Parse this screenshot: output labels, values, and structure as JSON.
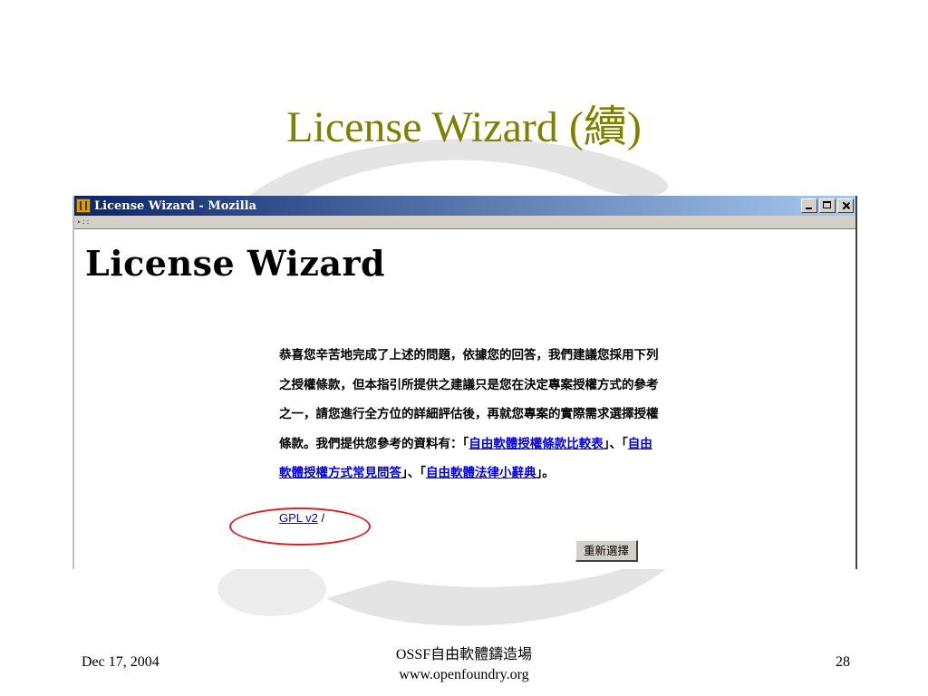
{
  "slide": {
    "title": "License Wizard (續)"
  },
  "window": {
    "title": "License Wizard - Mozilla",
    "icon": "mozilla-app-icon",
    "controls": [
      "minimize-icon",
      "maximize-icon",
      "close-icon"
    ]
  },
  "page": {
    "heading": "License Wizard",
    "paragraph": {
      "t1": "恭喜您辛苦地完成了上述的問題，依據您的回答，我們建議您採用下列之授權條款，但本指引所提供之建議只是您在決定專案授權方式的參考之一，請您進行全方位的詳細評估後，再就您專案的實際需求選擇授權條款。我們提供您參考的資料有：「",
      "link1": "自由軟體授權條款比較表",
      "t2": "」、「",
      "link2": "自由軟體授權方式常見問答",
      "t3": "」、「",
      "link3": "自由軟體法律小辭典",
      "t4": "」。"
    },
    "gpl_link": "GPL v2",
    "gpl_suffix": " /",
    "reset_button": "重新選擇"
  },
  "footer": {
    "date": "Dec 17, 2004",
    "org_line1": "OSSF自由軟體鑄造場",
    "org_line2": "www.openfoundry.org",
    "page_number": "28"
  },
  "colors": {
    "title": "#808000",
    "titlebar_start": "#0a246a",
    "titlebar_end": "#a6caf0",
    "link": "#0000ee",
    "highlight_oval": "#e02020"
  }
}
